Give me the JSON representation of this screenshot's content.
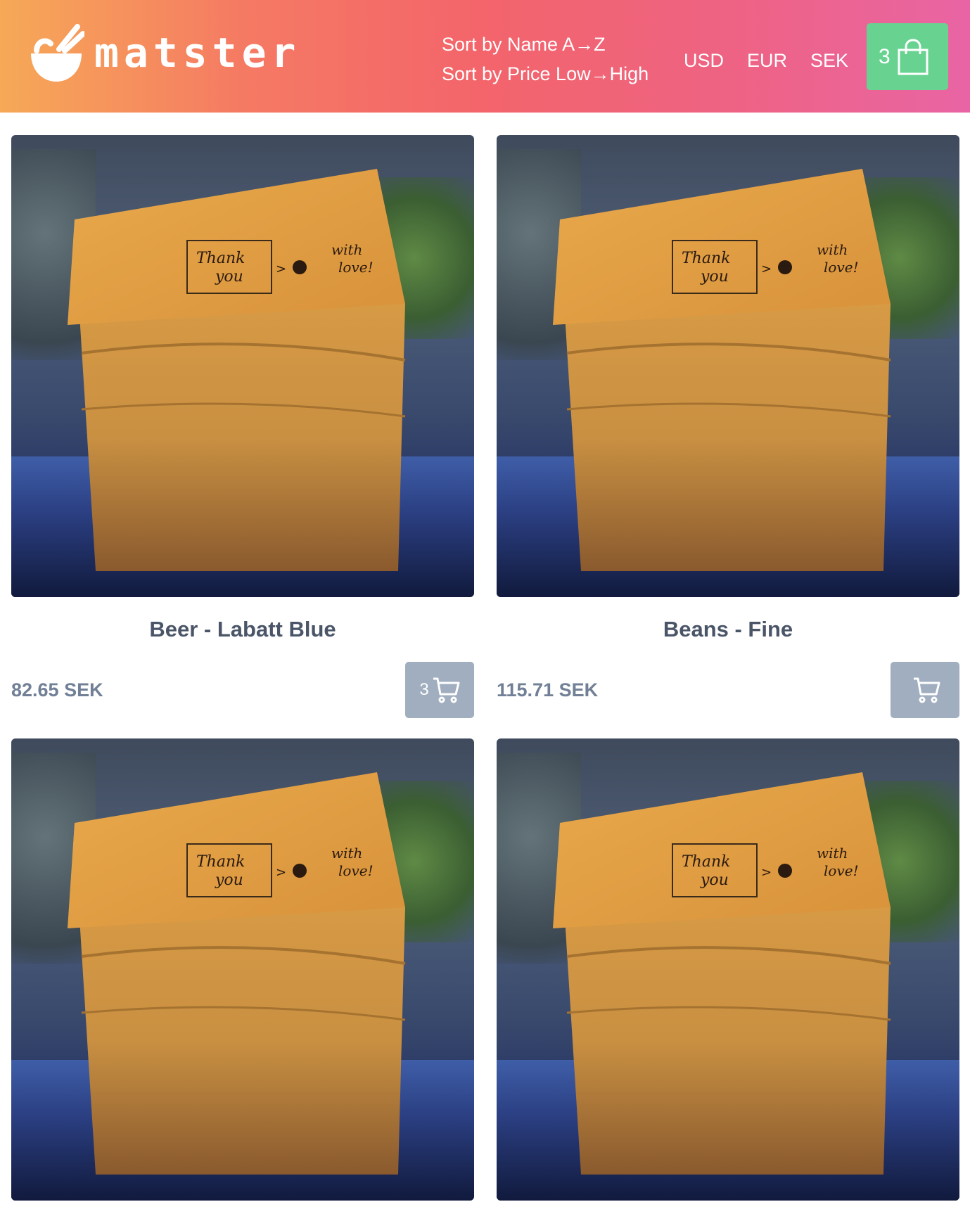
{
  "brand": {
    "name": "matster",
    "logo_icon": "bowl-chopsticks-icon"
  },
  "sort": {
    "name_label": "Sort by Name A→Z",
    "price_label": "Sort by Price Low→High"
  },
  "currencies": [
    "USD",
    "EUR",
    "SEK"
  ],
  "cart": {
    "count": "3",
    "icon": "shopping-bag-icon",
    "color": "#68d391"
  },
  "products": [
    {
      "name": "Beer - Labatt Blue",
      "price": "82.65 SEK",
      "cart_count": "3",
      "image_text": "Thank you > with love!"
    },
    {
      "name": "Beans - Fine",
      "price": "115.71 SEK",
      "cart_count": "",
      "image_text": "Thank you > with love!"
    },
    {
      "name": "",
      "price": "",
      "cart_count": "",
      "image_text": "Thank you > with love!"
    },
    {
      "name": "",
      "price": "",
      "cart_count": "",
      "image_text": "Thank you > with love!"
    }
  ],
  "colors": {
    "header_gradient": [
      "#f6a957",
      "#f3646b",
      "#e964a4"
    ],
    "button_gray": "#a0aec0",
    "text_dark": "#4a5568",
    "text_price": "#718096"
  }
}
